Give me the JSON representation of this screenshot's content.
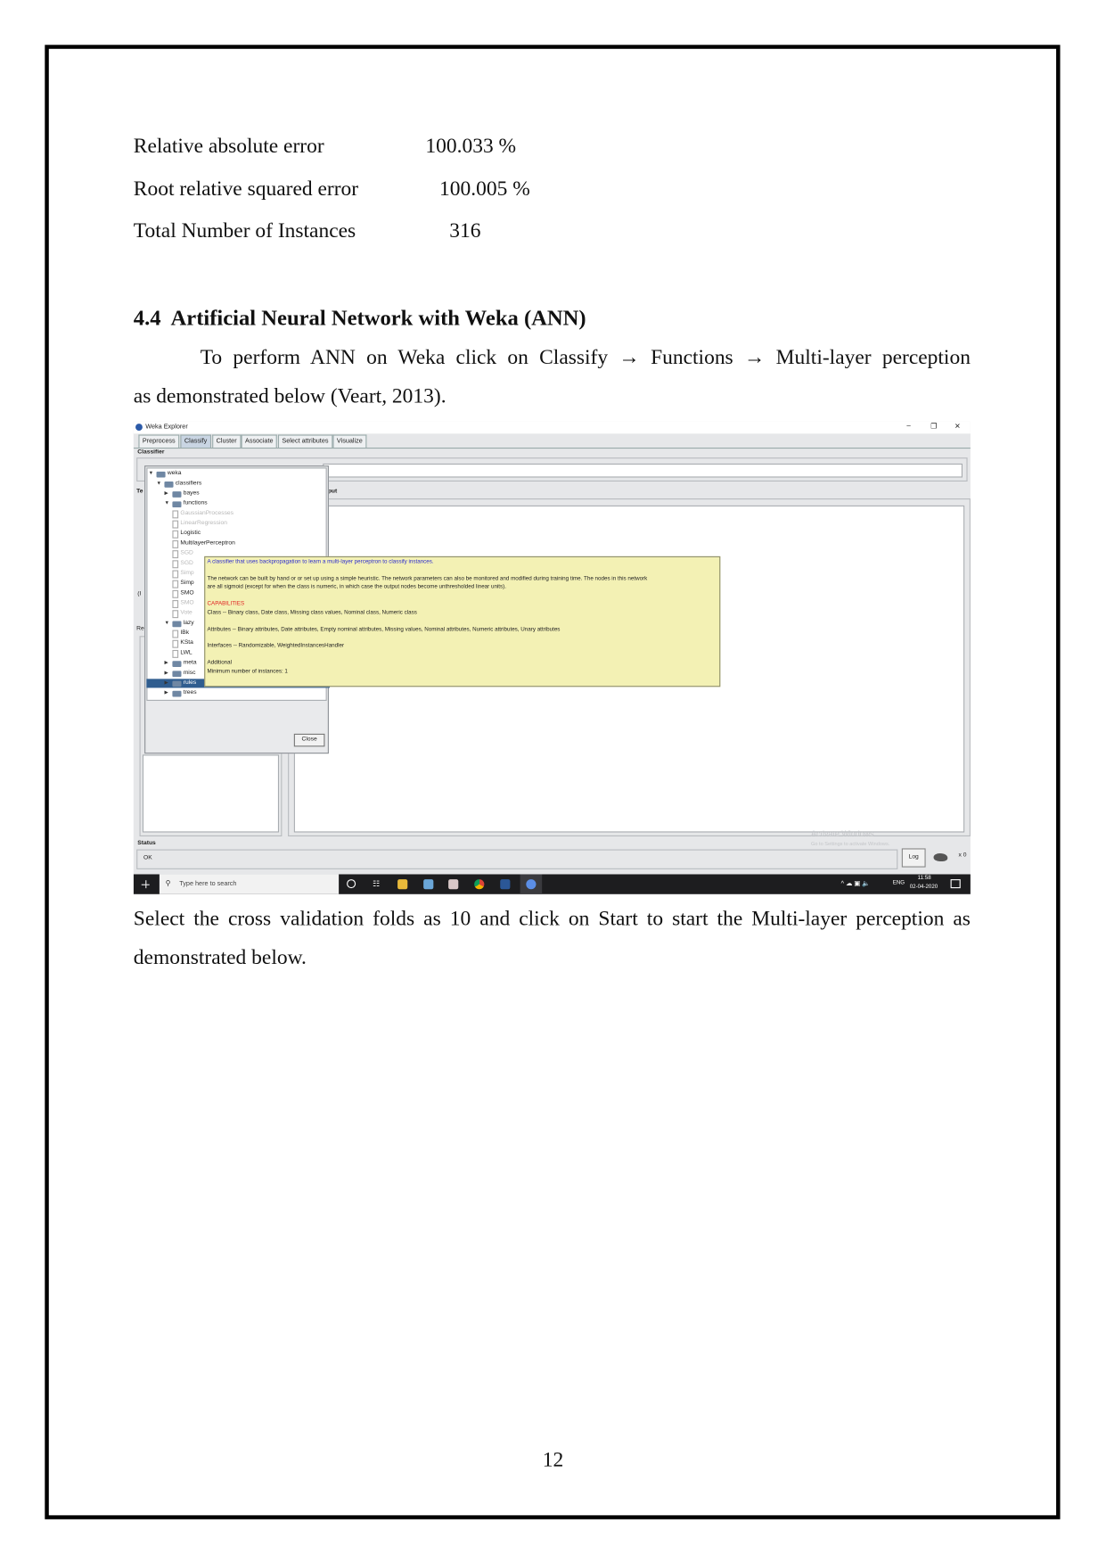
{
  "stats": [
    {
      "label": "Relative absolute error",
      "value": "100.033 %"
    },
    {
      "label": "Root relative squared error",
      "value": "100.005 %"
    },
    {
      "label": "Total Number of Instances",
      "value": "316"
    }
  ],
  "section": {
    "number": "4.4",
    "title": "Artificial Neural Network with Weka (ANN)"
  },
  "paragraph1": {
    "line1": "To perform ANN on Weka click on Classify → Functions → Multi-layer perception",
    "line2": "as demonstrated below (Veart, 2013)."
  },
  "screenshot": {
    "window_title": "Weka Explorer",
    "window_controls": [
      "–",
      "❒",
      "✕"
    ],
    "tabs": [
      {
        "label": "Preprocess",
        "selected": false
      },
      {
        "label": "Classify",
        "selected": true
      },
      {
        "label": "Cluster",
        "selected": false
      },
      {
        "label": "Associate",
        "selected": false
      },
      {
        "label": "Select attributes",
        "selected": false
      },
      {
        "label": "Visualize",
        "selected": false
      }
    ],
    "classifier_label": "Classifier",
    "test_options_label": "Te",
    "output_label": "put",
    "left_labels": [
      "(I",
      "Re"
    ],
    "tree": [
      {
        "label": "weka",
        "type": "folder",
        "expanded": true,
        "level": 0
      },
      {
        "label": "classifiers",
        "type": "folder",
        "expanded": true,
        "level": 1
      },
      {
        "label": "bayes",
        "type": "folder",
        "expanded": false,
        "level": 2
      },
      {
        "label": "functions",
        "type": "folder",
        "expanded": true,
        "level": 2
      },
      {
        "label": "GaussianProcesses",
        "type": "leaf",
        "disabled": true,
        "level": 3
      },
      {
        "label": "LinearRegression",
        "type": "leaf",
        "disabled": true,
        "level": 3
      },
      {
        "label": "Logistic",
        "type": "leaf",
        "disabled": false,
        "level": 3
      },
      {
        "label": "MultilayerPerceptron",
        "type": "leaf",
        "disabled": false,
        "level": 3
      },
      {
        "label": "SGD",
        "type": "leaf",
        "disabled": true,
        "level": 3
      },
      {
        "label": "SGD",
        "type": "leaf",
        "disabled": true,
        "level": 3
      },
      {
        "label": "Simp",
        "type": "leaf",
        "disabled": true,
        "level": 3
      },
      {
        "label": "Simp",
        "type": "leaf",
        "disabled": false,
        "level": 3
      },
      {
        "label": "SMO",
        "type": "leaf",
        "disabled": false,
        "level": 3
      },
      {
        "label": "SMO",
        "type": "leaf",
        "disabled": true,
        "level": 3
      },
      {
        "label": "Vote",
        "type": "leaf",
        "disabled": true,
        "level": 3
      },
      {
        "label": "lazy",
        "type": "folder",
        "expanded": true,
        "level": 2
      },
      {
        "label": "IBk",
        "type": "leaf",
        "disabled": false,
        "level": 3
      },
      {
        "label": "KSta",
        "type": "leaf",
        "disabled": false,
        "level": 3
      },
      {
        "label": "LWL",
        "type": "leaf",
        "disabled": false,
        "level": 3
      },
      {
        "label": "meta",
        "type": "folder",
        "expanded": false,
        "level": 2
      },
      {
        "label": "misc",
        "type": "folder",
        "expanded": false,
        "level": 2
      },
      {
        "label": "rules",
        "type": "folder",
        "expanded": false,
        "level": 2,
        "selected": true
      },
      {
        "label": "trees",
        "type": "folder",
        "expanded": false,
        "level": 2
      }
    ],
    "close_button": "Close",
    "tooltip": {
      "summary": "A classifier that uses backpropagation to learn a multi-layer perceptron to classify instances.",
      "desc1": "The network can be built by hand or or set up using a simple heuristic. The network parameters can also be monitored and modified during training time. The nodes in this network",
      "desc2": "are all sigmoid (except for when the class is numeric, in which case the output nodes become unthresholded linear units).",
      "capabilities_heading": "CAPABILITIES",
      "class_line": "Class -- Binary class, Date class, Missing class values, Nominal class, Numeric class",
      "attributes_line": "Attributes -- Binary attributes, Date attributes, Empty nominal attributes, Missing values, Nominal attributes, Numeric attributes, Unary attributes",
      "interfaces_line": "Interfaces -- Randomizable, WeightedInstancesHandler",
      "additional_heading": "Additional",
      "min_instances": "Minimum number of instances: 1",
      "summary_color": "#2a2ad0",
      "capabilities_color": "#e02020",
      "background": "#f3f1b4"
    },
    "watermark": {
      "line1": "Activate Windows",
      "line2": "Go to Settings to activate Windows."
    },
    "status_label": "Status",
    "status_text": "OK",
    "log_button": "Log",
    "task_count": "x 0",
    "taskbar": {
      "search_placeholder": "Type here to search",
      "language": "ENG",
      "time": "11:58",
      "date": "02-04-2020"
    }
  },
  "paragraph2": {
    "line1": "Select the cross validation folds as 10 and click on Start to start the Multi-layer perception as",
    "line2": "demonstrated below."
  },
  "page_number": "12"
}
